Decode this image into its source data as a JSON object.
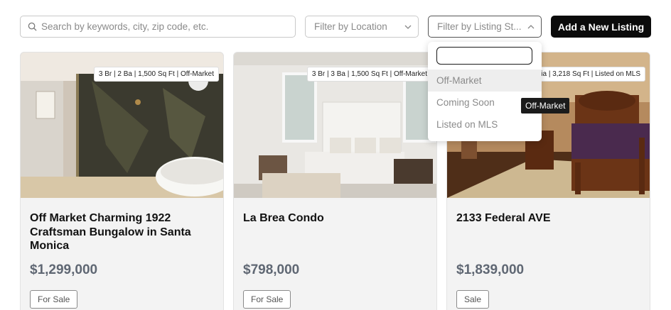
{
  "search": {
    "placeholder": "Search by keywords, city, zip code, etc.",
    "value": ""
  },
  "filters": {
    "location_placeholder": "Filter by Location",
    "status_placeholder": "Filter by Listing St..."
  },
  "add_button_label": "Add a New Listing",
  "status_dropdown": {
    "search_value": "",
    "options": [
      "Off-Market",
      "Coming Soon",
      "Listed on MLS"
    ],
    "highlighted": "Off-Market"
  },
  "tooltip_text": "Off-Market",
  "listings": [
    {
      "badge": "3 Br | 2 Ba | 1,500 Sq Ft | Off-Market",
      "title": "Off Market Charming 1922 Craftsman Bungalow in Santa Monica",
      "price": "$1,299,000",
      "tag": "For Sale"
    },
    {
      "badge": "3 Br | 3 Ba | 1,500 Sq Ft | Off-Market",
      "title": "La Brea Condo",
      "price": "$798,000",
      "tag": "For Sale"
    },
    {
      "badge": "ia | 3,218 Sq Ft | Listed on MLS",
      "title": "2133 Federal AVE",
      "price": "$1,839,000",
      "tag": "Sale"
    }
  ],
  "colors": {
    "accent": "#0b0b0b",
    "price": "#5f6773",
    "card_bg": "#f3f3f3"
  },
  "icons": {
    "search": "search-icon",
    "chevron": "chevron-down-icon",
    "chevron_up": "chevron-up-icon"
  }
}
